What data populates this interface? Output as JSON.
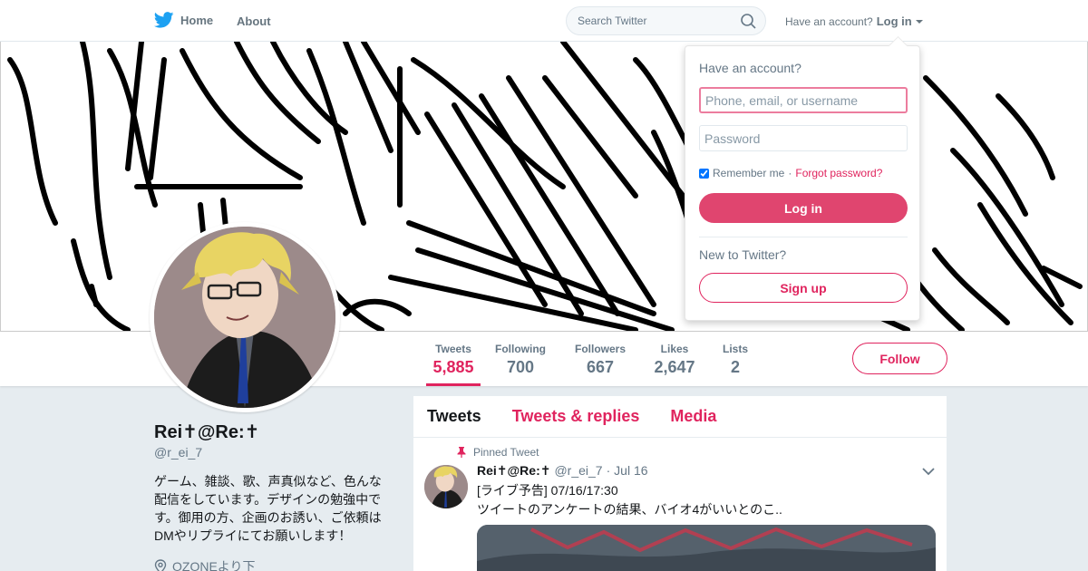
{
  "nav": {
    "home_label": "Home",
    "about_label": "About",
    "search_placeholder": "Search Twitter",
    "account_prompt": "Have an account?",
    "login_label": "Log in"
  },
  "colors": {
    "accent": "#e0245e",
    "brand": "#1da1f2",
    "background": "#e6ecf0"
  },
  "stats": [
    {
      "label": "Tweets",
      "value": "5,885"
    },
    {
      "label": "Following",
      "value": "700"
    },
    {
      "label": "Followers",
      "value": "667"
    },
    {
      "label": "Likes",
      "value": "2,647"
    },
    {
      "label": "Lists",
      "value": "2"
    }
  ],
  "follow_label": "Follow",
  "profile": {
    "name": "Rei✝@Re:✝",
    "handle": "@r_ei_7",
    "bio": "ゲーム、雑談、歌、声真似など、色んな配信をしています。デザインの勉強中です。御用の方、企画のお誘い、ご依頼はDMやリプライにてお願いします！",
    "location": "OZONEより下"
  },
  "timeline": {
    "tabs": [
      "Tweets",
      "Tweets & replies",
      "Media"
    ],
    "pinned_label": "Pinned Tweet",
    "tweet": {
      "name": "Rei✝@Re:✝",
      "handle": "@r_ei_7",
      "date": "· Jul 16",
      "line1": "[ライブ予告] 07/16/17:30",
      "line2": "ツイートのアンケートの結果、バイオ4がいいとのこ.."
    }
  },
  "login_dropdown": {
    "title": "Have an account?",
    "username_placeholder": "Phone, email, or username",
    "password_placeholder": "Password",
    "remember_label": "Remember me",
    "separator": "·",
    "forgot_label": "Forgot password?",
    "login_button": "Log in",
    "new_prompt": "New to Twitter?",
    "signup_button": "Sign up"
  },
  "icons": [
    "twitter-bird-icon",
    "search-icon",
    "caret-down-icon",
    "pin-icon",
    "location-icon",
    "chevron-down-icon"
  ]
}
